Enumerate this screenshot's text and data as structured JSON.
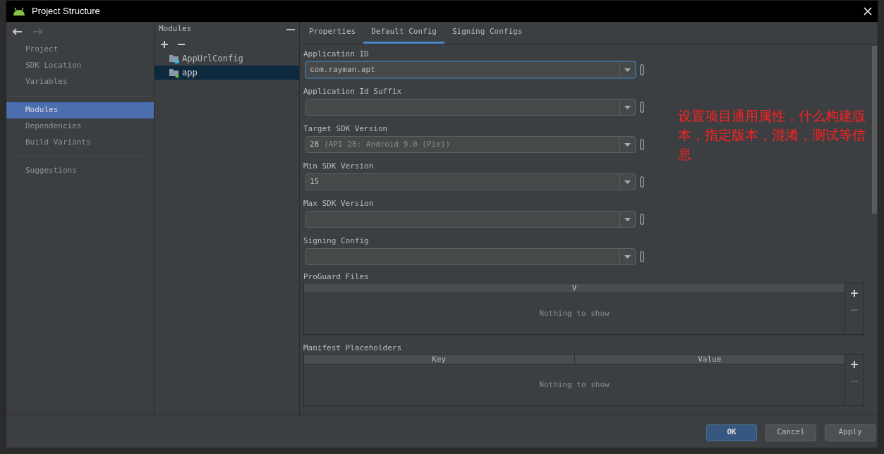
{
  "window": {
    "title": "Project Structure"
  },
  "nav": {
    "back_enabled": true,
    "forward_enabled": false
  },
  "sidebar": {
    "groups": [
      [
        {
          "label": "Project",
          "selected": false
        },
        {
          "label": "SDK Location",
          "selected": false
        },
        {
          "label": "Variables",
          "selected": false
        }
      ],
      [
        {
          "label": "Modules",
          "selected": true
        },
        {
          "label": "Dependencies",
          "selected": false
        },
        {
          "label": "Build Variants",
          "selected": false
        }
      ],
      [
        {
          "label": "Suggestions",
          "selected": false
        }
      ]
    ]
  },
  "modules": {
    "title": "Modules",
    "items": [
      {
        "label": "AppUrlConfig",
        "kind": "library",
        "selected": false
      },
      {
        "label": "app",
        "kind": "application",
        "selected": true
      }
    ]
  },
  "tabs": [
    {
      "label": "Properties",
      "selected": false
    },
    {
      "label": "Default Config",
      "selected": true
    },
    {
      "label": "Signing Configs",
      "selected": false
    }
  ],
  "fields": [
    {
      "label": "Application ID",
      "value": "com.rayman.apt",
      "focused": true
    },
    {
      "label": "Application Id Suffix",
      "focused": false
    },
    {
      "label": "Target SDK Version",
      "value": "28",
      "hint": "(API 28: Android 9.0 (Pie))",
      "focused": false
    },
    {
      "label": "Min SDK Version",
      "value": "15",
      "focused": false
    },
    {
      "label": "Max SDK Version",
      "focused": false
    },
    {
      "label": "Signing Config",
      "focused": false
    }
  ],
  "tables": [
    {
      "label": "ProGuard Files",
      "columns": [
        "V"
      ],
      "empty_text": "Nothing to show"
    },
    {
      "label": "Manifest Placeholders",
      "columns": [
        "Key",
        "Value"
      ],
      "empty_text": "Nothing to show"
    }
  ],
  "annotation": "设置项目通用属性，什么构建版本，指定版本，混淆，测试等信息",
  "buttons": [
    {
      "label": "OK",
      "default": true
    },
    {
      "label": "Cancel",
      "default": false
    },
    {
      "label": "Apply",
      "default": false
    }
  ]
}
